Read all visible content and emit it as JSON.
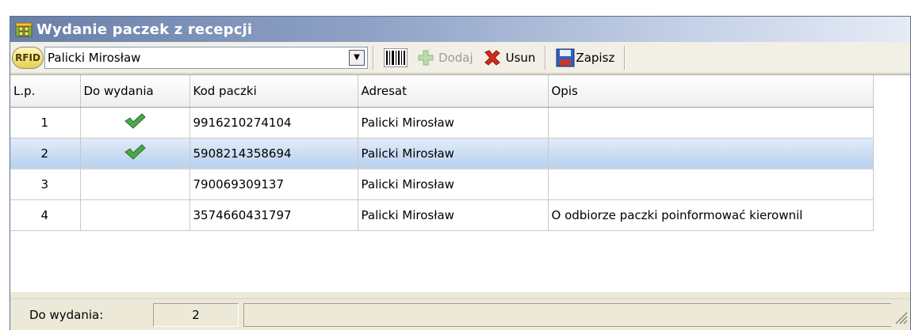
{
  "window": {
    "title": "Wydanie paczek z recepcji",
    "close_label": "×"
  },
  "toolbar": {
    "rfid_label": "RFID",
    "recipient_value": "Palicki Mirosław",
    "add_label": "Dodaj",
    "delete_label": "Usun",
    "save_label": "Zapisz"
  },
  "table": {
    "columns": [
      "L.p.",
      "Do wydania",
      "Kod paczki",
      "Adresat",
      "Opis"
    ],
    "rows": [
      {
        "lp": "1",
        "to_release": true,
        "code": "9916210274104",
        "recipient": "Palicki Mirosław",
        "description": ""
      },
      {
        "lp": "2",
        "to_release": true,
        "code": "5908214358694",
        "recipient": "Palicki Mirosław",
        "description": ""
      },
      {
        "lp": "3",
        "to_release": false,
        "code": "790069309137",
        "recipient": "Palicki Mirosław",
        "description": ""
      },
      {
        "lp": "4",
        "to_release": false,
        "code": "3574660431797",
        "recipient": "Palicki Mirosław",
        "description": "O odbiorze paczki poinformować kierownil"
      }
    ],
    "selected_row": 2
  },
  "status": {
    "label": "Do wydania:",
    "value": "2"
  },
  "icons": {
    "title": "packages-icon",
    "barcode": "barcode-icon",
    "add": "plus-icon",
    "delete": "red-x-icon",
    "save": "floppy-disk-icon",
    "check": "green-checkmark-icon"
  },
  "colors": {
    "check": "#4aa84a",
    "delete": "#d42a1a",
    "title_bar": "#6a7fa8",
    "selection": "#b7d0ee"
  }
}
